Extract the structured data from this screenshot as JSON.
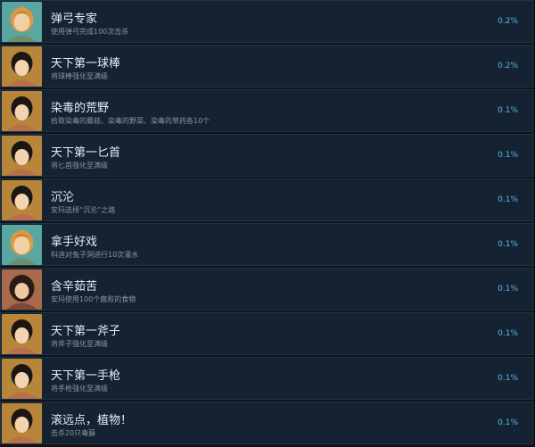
{
  "achievements": [
    {
      "title": "弹弓专家",
      "desc": "使用弹弓完成100次击杀",
      "percent": "0.2%",
      "avatar": "blonde-girl-icon"
    },
    {
      "title": "天下第一球棒",
      "desc": "将球棒强化至满级",
      "percent": "0.2%",
      "avatar": "dark-haired-boy-icon"
    },
    {
      "title": "染毒的荒野",
      "desc": "拾取染毒的蘑菇、染毒的野菜、染毒的草药各10个",
      "percent": "0.1%",
      "avatar": "dark-haired-boy-icon"
    },
    {
      "title": "天下第一匕首",
      "desc": "将匕首强化至满级",
      "percent": "0.1%",
      "avatar": "dark-haired-boy-icon"
    },
    {
      "title": "沉沦",
      "desc": "安玛选择“沉沦”之路",
      "percent": "0.1%",
      "avatar": "dark-haired-boy-icon"
    },
    {
      "title": "拿手好戏",
      "desc": "科迪对兔子洞进行10次灌水",
      "percent": "0.1%",
      "avatar": "blonde-girl-icon"
    },
    {
      "title": "含辛茹苦",
      "desc": "安玛使用100个腐败的食物",
      "percent": "0.1%",
      "avatar": "dark-haired-girl-icon"
    },
    {
      "title": "天下第一斧子",
      "desc": "将斧子强化至满级",
      "percent": "0.1%",
      "avatar": "dark-haired-boy-icon"
    },
    {
      "title": "天下第一手枪",
      "desc": "将手枪强化至满级",
      "percent": "0.1%",
      "avatar": "dark-haired-boy-icon"
    },
    {
      "title": "滚远点，植物！",
      "desc": "击杀20只毒藤",
      "percent": "0.1%",
      "avatar": "dark-haired-boy-icon"
    }
  ],
  "colors": {
    "background": "#0e141b",
    "row": "#152231",
    "title": "#e7edf3",
    "desc": "#8a96a3",
    "percent": "#5fb3e6"
  }
}
